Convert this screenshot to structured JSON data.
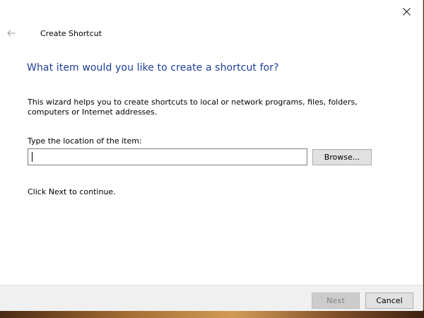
{
  "window": {
    "title": "Create Shortcut"
  },
  "content": {
    "main_instruction": "What item would you like to create a shortcut for?",
    "description": "This wizard helps you to create shortcuts to local or network programs, files, folders, computers or Internet addresses.",
    "location_label": "Type the location of the item:",
    "location_value": "",
    "browse_label": "Browse...",
    "hint": "Click Next to continue."
  },
  "footer": {
    "next_label": "Next",
    "next_enabled": false,
    "cancel_label": "Cancel"
  },
  "icons": {
    "close": "close-icon",
    "back": "back-arrow-icon"
  },
  "colors": {
    "main_instruction": "#1e3e9a",
    "footer_background": "#f0f0f0",
    "button_face": "#e1e1e1",
    "disabled_text": "#838383"
  }
}
